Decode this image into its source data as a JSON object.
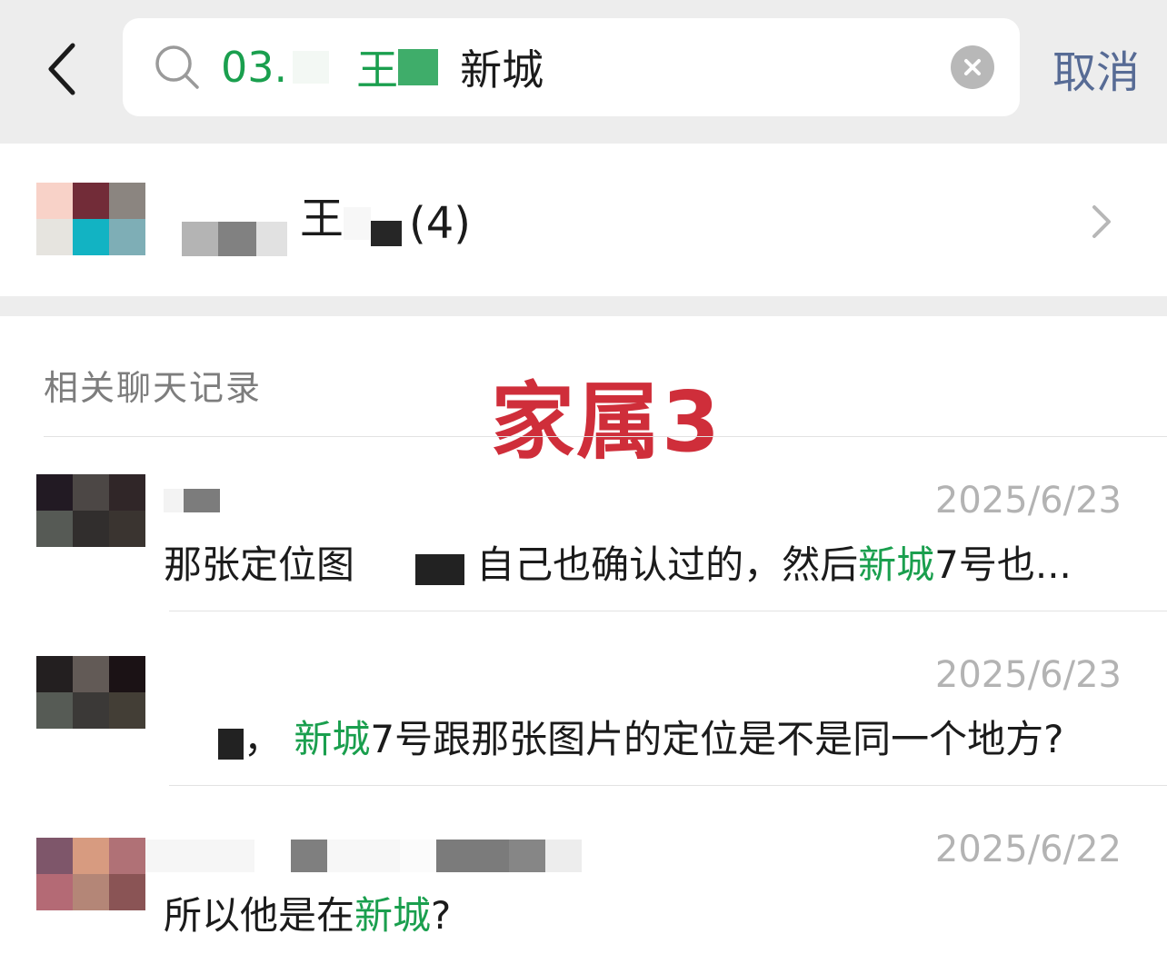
{
  "search": {
    "query_part1": "03.",
    "query_part2": "王",
    "query_part3": "新城"
  },
  "header": {
    "cancel_label": "取消"
  },
  "contact": {
    "name_char": "王",
    "count": "(4)"
  },
  "section": {
    "title": "相关聊天记录"
  },
  "watermark": "家属3",
  "messages": [
    {
      "date": "2025/6/23",
      "text_a": "那张定位图",
      "text_b": "自己也确认过的，然后",
      "text_hl": "新城",
      "text_c": "7号也..."
    },
    {
      "date": "2025/6/23",
      "text_a": "，",
      "text_hl": "新城",
      "text_c": "7号跟那张图片的定位是不是同一个地方?"
    },
    {
      "date": "2025/6/22",
      "text_a": "所以他是在",
      "text_hl": "新城",
      "text_c": "?"
    }
  ],
  "icons": [
    "back-arrow-icon",
    "search-icon",
    "clear-icon",
    "chevron-right-icon"
  ],
  "colors": {
    "header_bg": "#ededed",
    "highlight_green": "#1a9f4e",
    "cancel_blue": "#576b95",
    "watermark_red": "#cf2e3a",
    "date_gray": "#b3b3b3"
  }
}
